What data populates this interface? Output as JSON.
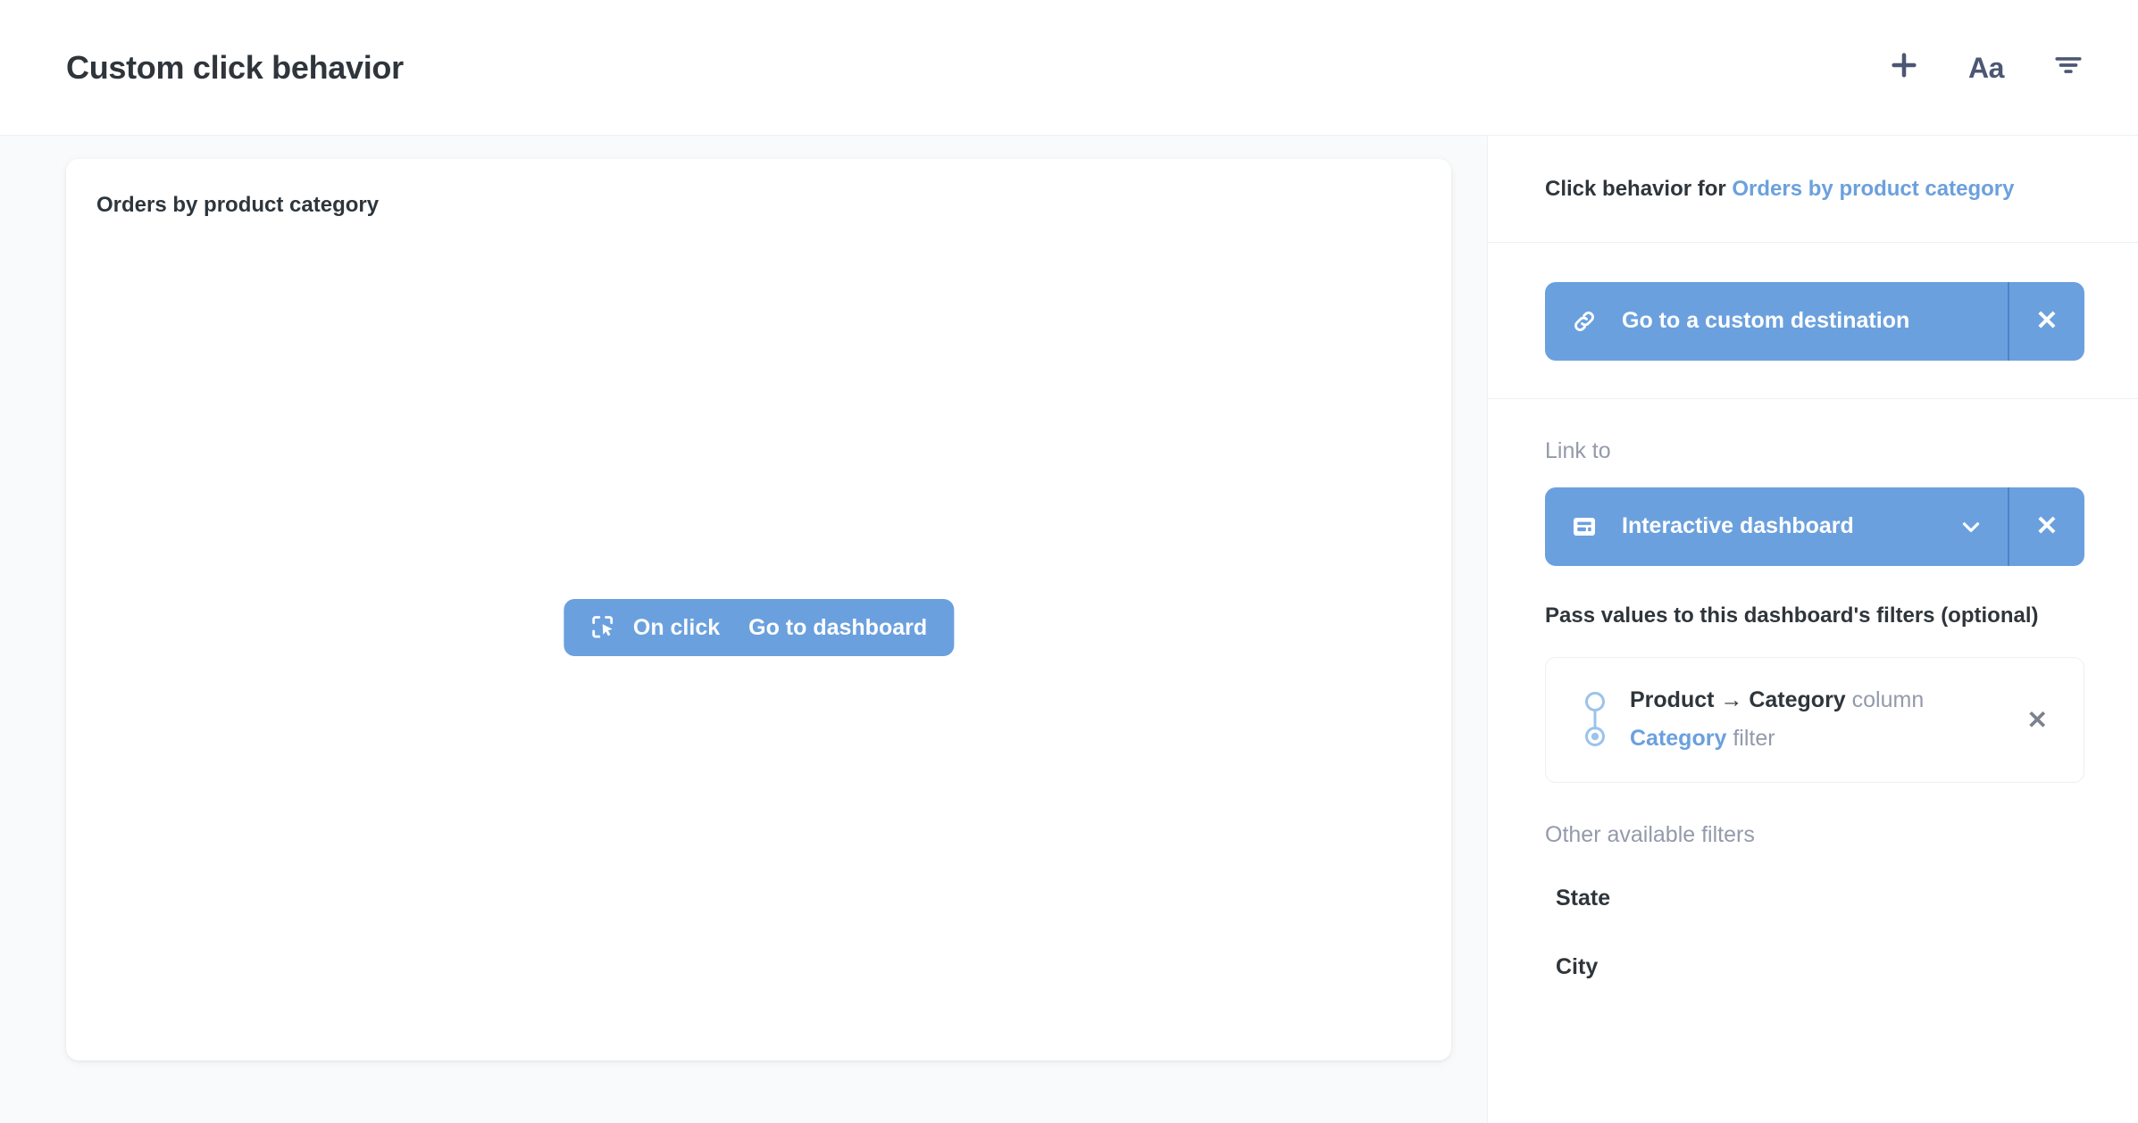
{
  "header": {
    "title": "Custom click behavior",
    "actions": [
      {
        "name": "add-button",
        "icon": "plus-icon",
        "label": "+"
      },
      {
        "name": "text-button",
        "icon": "text-aa-icon",
        "label": "Aa"
      },
      {
        "name": "filter-button",
        "icon": "filter-icon",
        "label": ""
      }
    ]
  },
  "canvas": {
    "card": {
      "title": "Orders by product category",
      "click_pill": {
        "icon": "click-target-icon",
        "prefix_label": "On click",
        "action_label": "Go to dashboard"
      }
    }
  },
  "sidebar": {
    "header": {
      "prefix": "Click behavior for ",
      "target": "Orders by product category"
    },
    "behavior": {
      "icon": "link-icon",
      "label": "Go to a custom destination",
      "close_label": "✕"
    },
    "link_to": {
      "field_label": "Link to",
      "icon": "dashboard-icon",
      "value": "Interactive dashboard",
      "close_label": "✕"
    },
    "filters": {
      "heading": "Pass values to this dashboard's filters (optional)",
      "mapping": {
        "column_name": "Product → Category",
        "column_suffix": "column",
        "filter_name": "Category",
        "filter_suffix": "filter",
        "close_label": "✕"
      },
      "other_heading": "Other available filters",
      "other_filters": [
        {
          "label": "State"
        },
        {
          "label": "City"
        }
      ]
    }
  },
  "colors": {
    "accent_blue": "#6BA0DE",
    "divider_blue": "#4A84C9",
    "text_dark": "#2E353B",
    "text_muted": "#949AAB",
    "canvas_bg": "#F9FAFB",
    "border": "#EEF0F2"
  }
}
